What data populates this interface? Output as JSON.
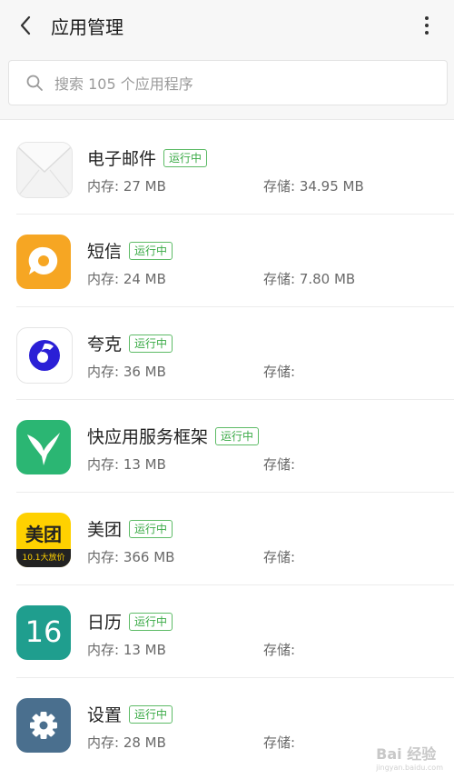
{
  "header": {
    "title": "应用管理"
  },
  "search": {
    "placeholder": "搜索 105 个应用程序"
  },
  "apps": [
    {
      "name": "电子邮件",
      "badge": "运行中",
      "memory": "内存: 27 MB",
      "storage": "存储: 34.95 MB"
    },
    {
      "name": "短信",
      "badge": "运行中",
      "memory": "内存: 24 MB",
      "storage": "存储: 7.80 MB"
    },
    {
      "name": "夸克",
      "badge": "运行中",
      "memory": "内存: 36 MB",
      "storage": "存储:"
    },
    {
      "name": "快应用服务框架",
      "badge": "运行中",
      "memory": "内存: 13 MB",
      "storage": "存储:"
    },
    {
      "name": "美团",
      "badge": "运行中",
      "memory": "内存: 366 MB",
      "storage": "存储:",
      "icon_text": "美团",
      "icon_subtext": "10.1大放价"
    },
    {
      "name": "日历",
      "badge": "运行中",
      "memory": "内存: 13 MB",
      "storage": "存储:",
      "icon_text": "16"
    },
    {
      "name": "设置",
      "badge": "运行中",
      "memory": "内存: 28 MB",
      "storage": "存储:"
    }
  ],
  "watermark": {
    "text": "Bai 经验",
    "subtext": "jingyan.baidu.com"
  },
  "colors": {
    "badge_green": "#3aaa46",
    "sms_orange": "#f6a623",
    "quark_blue": "#2a1fd6",
    "quickapp_green": "#2bb673",
    "meituan_yellow": "#ffd100",
    "calendar_teal": "#1f9e8e",
    "settings_blue": "#4a6f8e"
  }
}
